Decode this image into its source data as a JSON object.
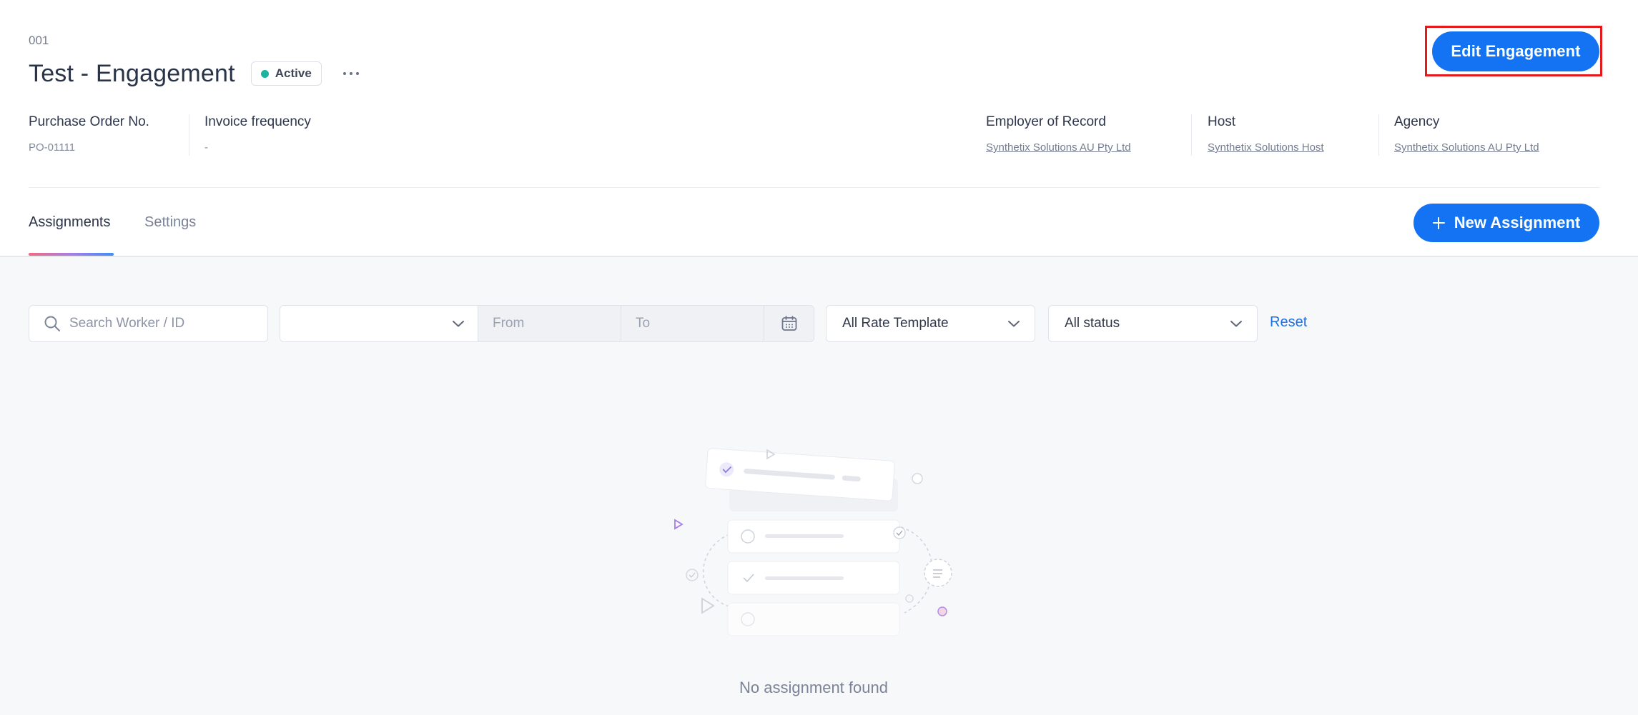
{
  "engagement": {
    "code": "001",
    "title": "Test - Engagement",
    "status": "Active",
    "status_color": "#1fb2a0"
  },
  "actions": {
    "edit_label": "Edit Engagement",
    "new_assignment_label": "New Assignment"
  },
  "meta": {
    "po_label": "Purchase Order No.",
    "po_value": "PO-01111",
    "invoice_label": "Invoice frequency",
    "invoice_value": "-",
    "employer_label": "Employer of Record",
    "employer_value": "Synthetix Solutions AU Pty Ltd",
    "host_label": "Host",
    "host_value": "Synthetix Solutions Host",
    "agency_label": "Agency",
    "agency_value": "Synthetix Solutions AU Pty Ltd"
  },
  "tabs": [
    {
      "label": "Assignments",
      "active": true
    },
    {
      "label": "Settings",
      "active": false
    }
  ],
  "filters": {
    "search_placeholder": "Search Worker / ID",
    "date_type_value": "",
    "from_placeholder": "From",
    "to_placeholder": "To",
    "rate_template": "All Rate Template",
    "status": "All status",
    "reset_label": "Reset"
  },
  "empty": {
    "message": "No assignment found"
  },
  "colors": {
    "primary": "#1473f2",
    "highlight": "#e51a1a"
  }
}
